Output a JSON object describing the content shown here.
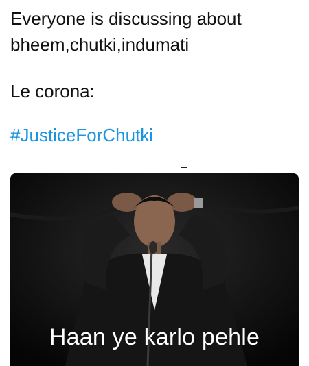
{
  "post": {
    "line1": "Everyone is discussing about",
    "line2": "bheem,chutki,indumati",
    "line3": "Le corona:",
    "hashtag": "#JusticeForChutki"
  },
  "meme": {
    "caption": "Haan ye karlo pehle"
  },
  "colors": {
    "text": "#111111",
    "hashtag": "#1b95e0",
    "meme_background": "#000000",
    "caption": "#ffffff"
  }
}
